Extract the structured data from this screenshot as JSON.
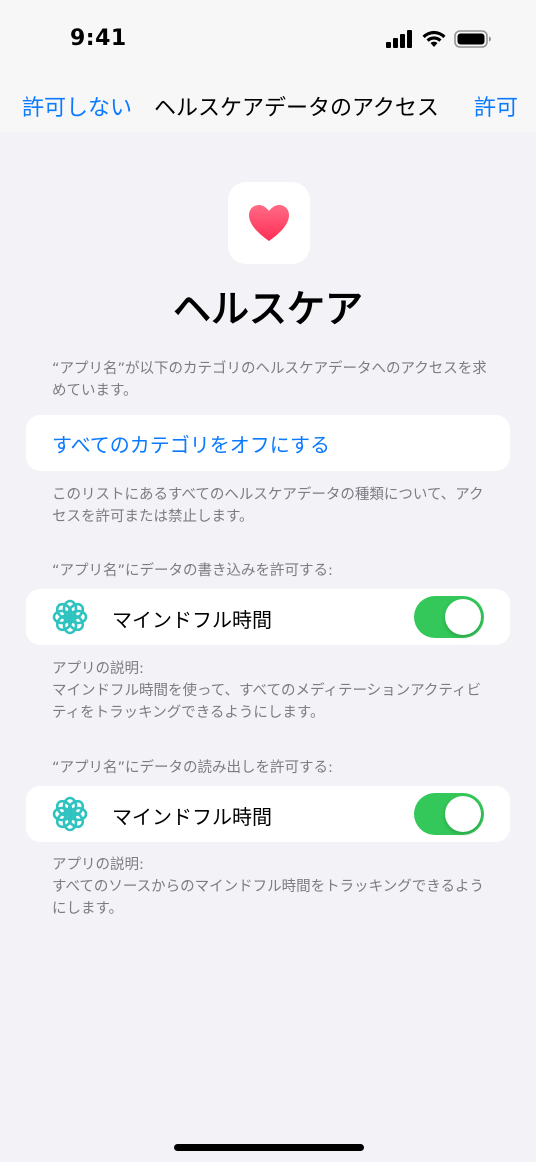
{
  "status_bar": {
    "time": "9:41"
  },
  "nav": {
    "cancel_label": "許可しない",
    "title": "ヘルスケアデータのアクセス",
    "allow_label": "許可"
  },
  "app": {
    "name": "ヘルスケア",
    "request_text": "“アプリ名”が以下のカテゴリのヘルスケアデータへのアクセスを求めています。"
  },
  "categories": {
    "turn_off_all_label": "すべてのカテゴリをオフにする",
    "footer": "このリストにあるすべてのヘルスケアデータの種類について、アクセスを許可または禁止します。"
  },
  "write_section": {
    "header": "“アプリ名”にデータの書き込みを許可する:",
    "item_label": "マインドフル時間",
    "item_icon": "mindfulness-icon",
    "enabled": true,
    "explanation_title": "アプリの説明:",
    "explanation": "マインドフル時間を使って、すべてのメディテーションアクティビティをトラッキングできるようにします。"
  },
  "read_section": {
    "header": "“アプリ名”にデータの読み出しを許可する:",
    "item_label": "マインドフル時間",
    "item_icon": "mindfulness-icon",
    "enabled": true,
    "explanation_title": "アプリの説明:",
    "explanation": "すべてのソースからのマインドフル時間をトラッキングできるようにします。"
  },
  "colors": {
    "accent": "#0A7AFF",
    "toggle_on": "#34C759",
    "mindful_icon": "#2FC3C0",
    "heart": "#FF2D55",
    "background": "#F2F2F7",
    "secondary_text": "#7C7C82"
  }
}
